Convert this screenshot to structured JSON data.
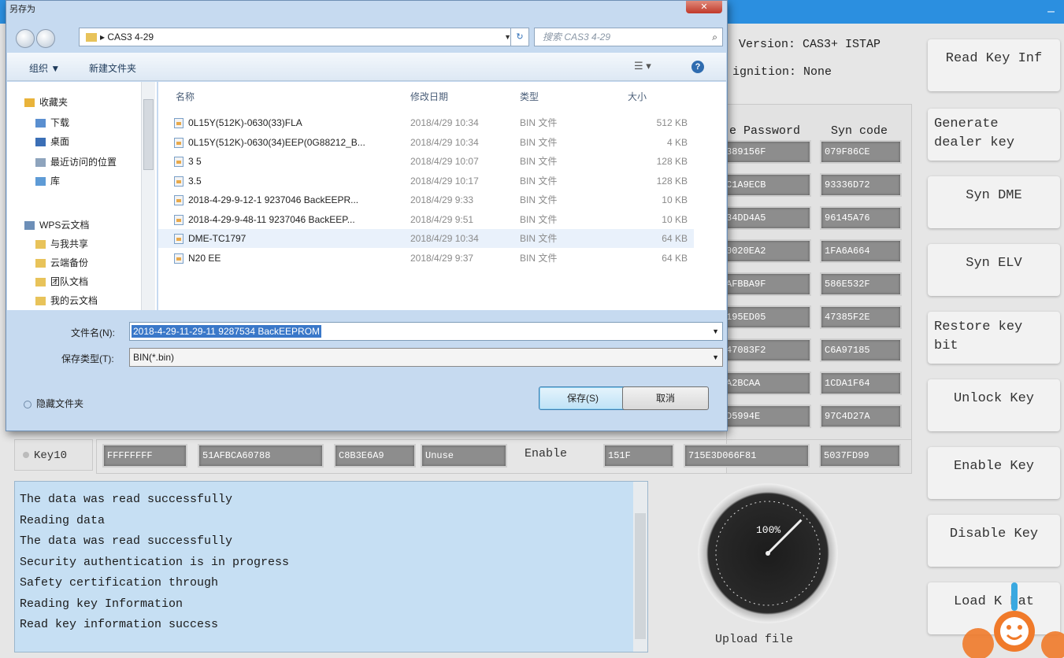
{
  "app": {
    "version_label": "Version: CAS3+ ISTAP",
    "ignition_label": "ignition: None",
    "table_headers": {
      "password": "e Password",
      "syn": "Syn code"
    },
    "rows": [
      {
        "password": "389156F",
        "syn": "079F86CE"
      },
      {
        "password": "C1A9ECB",
        "syn": "93336D72"
      },
      {
        "password": "34DD4A5",
        "syn": "96145A76"
      },
      {
        "password": "0020EA2",
        "syn": "1FA6A664"
      },
      {
        "password": "AFBBA9F",
        "syn": "586E532F"
      },
      {
        "password": "195ED05",
        "syn": "47385F2E"
      },
      {
        "password": "47083F2",
        "syn": "C6A97185"
      },
      {
        "password": "A2BCAA",
        "syn": "1CDA1F64"
      },
      {
        "password": "D5994E",
        "syn": "97C4D27A"
      }
    ],
    "key10": {
      "label": "Key10",
      "c1": "FFFFFFFF",
      "c2": "51AFBCA60788",
      "c3": "C8B3E6A9",
      "c4": "Unuse",
      "enable": "Enable",
      "c5": "151F",
      "c6": "715E3D066F81",
      "c7": "5037FD99"
    },
    "buttons": {
      "read_key_info": "Read Key Inf",
      "generate_dealer_key_1": "Generate",
      "generate_dealer_key_2": "dealer key",
      "syn_dme": "Syn DME",
      "syn_elv": "Syn ELV",
      "restore_key_bit_1": "Restore key",
      "restore_key_bit_2": "bit",
      "unlock_key": "Unlock Key",
      "enable_key": "Enable Key",
      "disable_key": "Disable Key",
      "load_key_data": "Load K   Dat"
    },
    "log_lines": [
      "The data was read successfully",
      "Reading data",
      "The data was read successfully",
      "Security authentication is in progress",
      "Safety certification through",
      "Reading key Information",
      "Read key information success"
    ],
    "gauge": {
      "percent_label": "100%",
      "value": 1.0,
      "caption": "Upload file"
    }
  },
  "dialog": {
    "title": "另存为",
    "close_label": "✕",
    "path": "CAS3  4-29",
    "search_placeholder": "搜索 CAS3  4-29",
    "toolbar": {
      "organize": "组织 ▼",
      "new_folder": "新建文件夹",
      "view": "☰ ▾",
      "help": "?"
    },
    "nav_items": [
      {
        "label": "收藏夹",
        "icon": "star-icon",
        "color": "#e9b33a"
      },
      {
        "label": "下载",
        "icon": "download-folder-icon",
        "color": "#5a8fd0"
      },
      {
        "label": "桌面",
        "icon": "desktop-icon",
        "color": "#3b6fb6"
      },
      {
        "label": "最近访问的位置",
        "icon": "recent-places-icon",
        "color": "#8ea4bd"
      },
      {
        "label": "库",
        "icon": "library-icon",
        "color": "#5e9bd6"
      },
      {
        "label": "WPS云文档",
        "icon": "cloud-icon",
        "color": "#6d8fb8"
      },
      {
        "label": "与我共享",
        "icon": "folder-icon",
        "color": "#e8c35a"
      },
      {
        "label": "云端备份",
        "icon": "folder-icon",
        "color": "#e8c35a"
      },
      {
        "label": "团队文档",
        "icon": "folder-icon",
        "color": "#e8c35a"
      },
      {
        "label": "我的云文档",
        "icon": "folder-icon",
        "color": "#e8c35a"
      }
    ],
    "columns": {
      "name": "名称",
      "date": "修改日期",
      "type": "类型",
      "size": "大小"
    },
    "files": [
      {
        "name": "0L15Y(512K)-0630(33)FLA",
        "date": "2018/4/29 10:34",
        "type": "BIN 文件",
        "size": "512 KB"
      },
      {
        "name": "0L15Y(512K)-0630(34)EEP(0G88212_B...",
        "date": "2018/4/29 10:34",
        "type": "BIN 文件",
        "size": "4 KB"
      },
      {
        "name": "3  5",
        "date": "2018/4/29 10:07",
        "type": "BIN 文件",
        "size": "128 KB"
      },
      {
        "name": "3.5",
        "date": "2018/4/29 10:17",
        "type": "BIN 文件",
        "size": "128 KB"
      },
      {
        "name": "2018-4-29-9-12-1 9237046 BackEEPR...",
        "date": "2018/4/29 9:33",
        "type": "BIN 文件",
        "size": "10 KB"
      },
      {
        "name": "2018-4-29-9-48-11 9237046 BackEEP...",
        "date": "2018/4/29 9:51",
        "type": "BIN 文件",
        "size": "10 KB"
      },
      {
        "name": "DME-TC1797",
        "date": "2018/4/29 10:34",
        "type": "BIN 文件",
        "size": "64 KB"
      },
      {
        "name": "N20 EE",
        "date": "2018/4/29 9:37",
        "type": "BIN 文件",
        "size": "64 KB"
      }
    ],
    "filename_label": "文件名(N):",
    "filename_value": "2018-4-29-11-29-11 9287534 BackEEPROM",
    "filetype_label": "保存类型(T):",
    "filetype_value": "BIN(*.bin)",
    "hide_folders": "隐藏文件夹",
    "save_label": "保存(S)",
    "cancel_label": "取消"
  }
}
